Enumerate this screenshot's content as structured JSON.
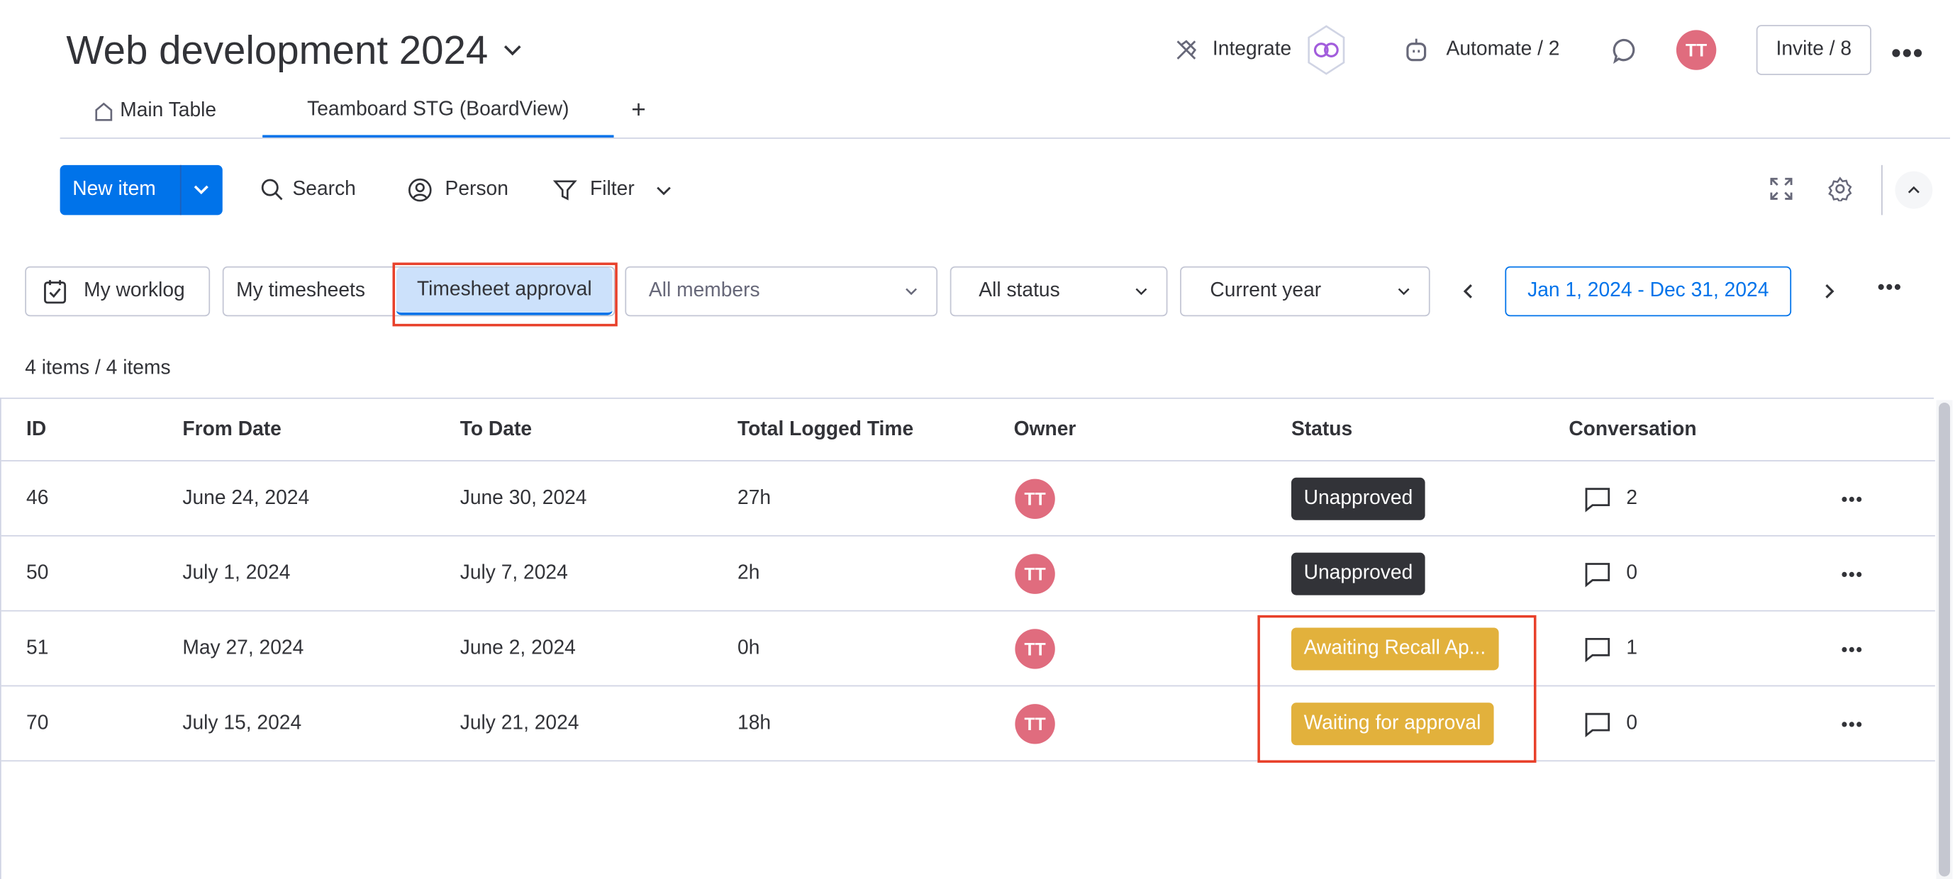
{
  "header": {
    "title": "Web development 2024",
    "integrate": "Integrate",
    "automate": "Automate / 2",
    "avatar": "TT",
    "invite": "Invite / 8"
  },
  "tabs": [
    {
      "label": "Main Table"
    },
    {
      "label": "Teamboard STG (BoardView)",
      "active": true
    }
  ],
  "add_tab": "+",
  "toolbar": {
    "new_item": "New item",
    "search": "Search",
    "person": "Person",
    "filter": "Filter"
  },
  "filters": {
    "my_worklog": "My worklog",
    "my_timesheets": "My timesheets",
    "timesheet_approval": "Timesheet approval",
    "members": "All members",
    "status": "All status",
    "period": "Current year",
    "date_range": "Jan 1, 2024 - Dec 31, 2024"
  },
  "count": "4 items / 4 items",
  "table": {
    "columns": [
      "ID",
      "From Date",
      "To Date",
      "Total Logged Time",
      "Owner",
      "Status",
      "Conversation"
    ],
    "rows": [
      {
        "id": "46",
        "from": "June 24, 2024",
        "to": "June 30, 2024",
        "total": "27h",
        "owner": "TT",
        "status": "Unapproved",
        "status_color": "#323338",
        "conversation": "2"
      },
      {
        "id": "50",
        "from": "July 1, 2024",
        "to": "July 7, 2024",
        "total": "2h",
        "owner": "TT",
        "status": "Unapproved",
        "status_color": "#323338",
        "conversation": "0"
      },
      {
        "id": "51",
        "from": "May 27, 2024",
        "to": "June 2, 2024",
        "total": "0h",
        "owner": "TT",
        "status": "Awaiting Recall Ap...",
        "status_color": "#e2b13c",
        "conversation": "1"
      },
      {
        "id": "70",
        "from": "July 15, 2024",
        "to": "July 21, 2024",
        "total": "18h",
        "owner": "TT",
        "status": "Waiting for approval",
        "status_color": "#e2b13c",
        "conversation": "0"
      }
    ]
  },
  "colors": {
    "primary": "#0073ea",
    "highlight": "#e8402a",
    "avatar": "#e06c7e"
  }
}
